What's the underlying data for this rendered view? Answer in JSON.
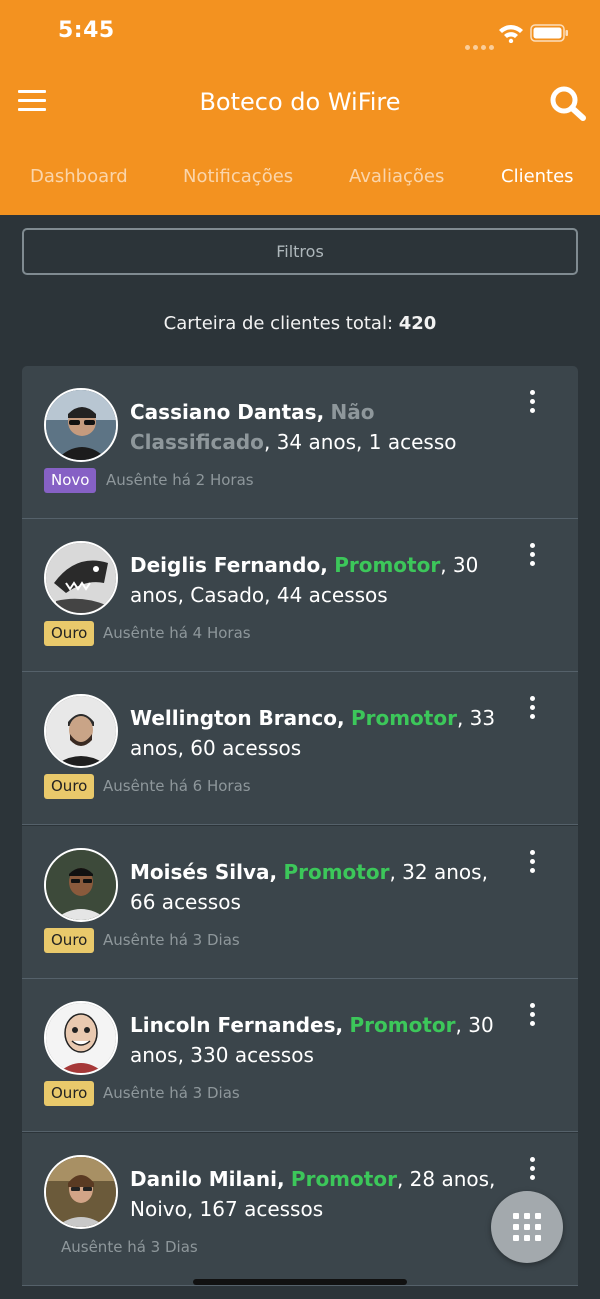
{
  "status_bar": {
    "time": "5:45"
  },
  "header": {
    "title": "Boteco do WiFire"
  },
  "tabs": [
    {
      "label": "Dashboard"
    },
    {
      "label": "Notificações"
    },
    {
      "label": "Avaliações"
    },
    {
      "label": "Clientes",
      "active": true
    }
  ],
  "filters": {
    "label": "Filtros"
  },
  "summary": {
    "label": "Carteira de clientes total:",
    "count": "420"
  },
  "clients": [
    {
      "name": "Cassiano Dantas,",
      "classification": "Não Classificado",
      "details": ", 34 anos, 1 acesso",
      "badge": "Novo",
      "absent": "Ausênte há 2 Horas"
    },
    {
      "name": "Deiglis Fernando,",
      "classification": "Promotor",
      "details": ", 30 anos, Casado, 44 acessos",
      "badge": "Ouro",
      "absent": "Ausênte há 4 Horas"
    },
    {
      "name": "Wellington Branco,",
      "classification": "Promotor",
      "details": ", 33 anos, 60 acessos",
      "badge": "Ouro",
      "absent": "Ausênte há 6 Horas"
    },
    {
      "name": "Moisés Silva,",
      "classification": "Promotor",
      "details": ", 32 anos, 66 acessos",
      "badge": "Ouro",
      "absent": "Ausênte há 3 Dias"
    },
    {
      "name": "Lincoln Fernandes,",
      "classification": "Promotor",
      "details": ", 30 anos, 330 acessos",
      "badge": "Ouro",
      "absent": "Ausênte há 3 Dias"
    },
    {
      "name": "Danilo Milani,",
      "classification": "Promotor",
      "details": ", 28 anos, Noivo, 167 acessos",
      "badge": "",
      "absent": "Ausênte há 3 Dias"
    }
  ],
  "colors": {
    "header": "#f39220",
    "background": "#2c3439",
    "card": "#3b454b",
    "promotor": "#3cc75a",
    "badge_novo": "#8661c5",
    "badge_ouro": "#e9c96b"
  },
  "icons": {
    "menu": "hamburger-icon",
    "search": "search-icon",
    "more": "kebab-icon",
    "fab": "grid-icon"
  }
}
